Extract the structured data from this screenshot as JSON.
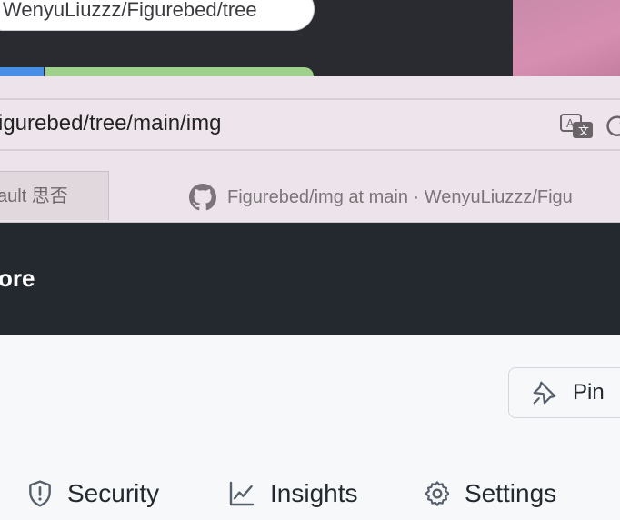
{
  "background": {
    "tag_text": "WenyuLiuzzz/Figurebed/tree"
  },
  "browser": {
    "address": "igurebed/tree/main/img",
    "left_tab_label": "ault 思否",
    "active_tab_title": "Figurebed/img at main · WenyuLiuzzz/Figu"
  },
  "header": {
    "text": "ore"
  },
  "repo_actions": {
    "pin_label": "Pin"
  },
  "repo_nav": [
    {
      "label": "Security",
      "icon": "shield-icon"
    },
    {
      "label": "Insights",
      "icon": "graph-icon"
    },
    {
      "label": "Settings",
      "icon": "gear-icon"
    }
  ],
  "colors": {
    "header_bg": "#24292f",
    "page_bg": "#f6f8fa",
    "browser_bg": "#ece4ea"
  }
}
